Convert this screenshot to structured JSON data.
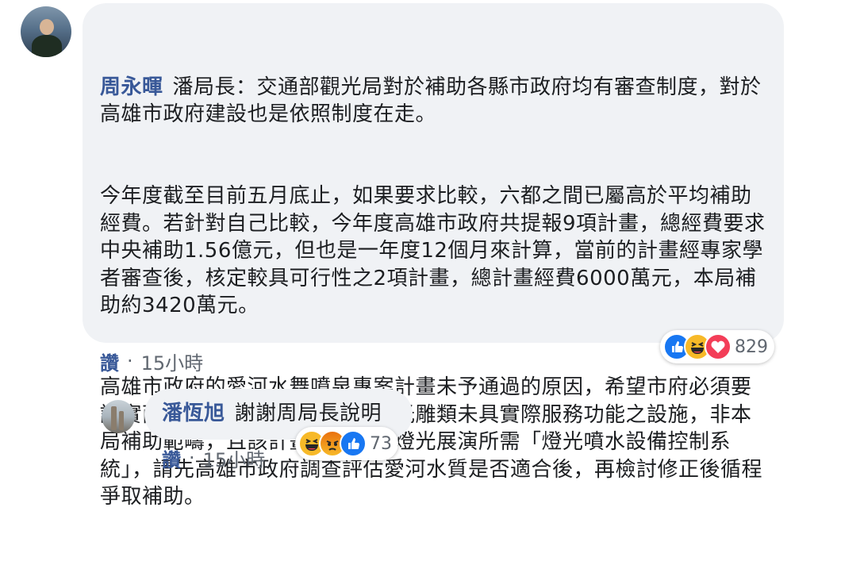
{
  "comments": [
    {
      "author": "周永暉",
      "paragraphs": [
        "潘局長：交通部觀光局對於補助各縣市政府均有審查制度，對於高雄市政府建設也是依照制度在走。",
        "今年度截至目前五月底止，如果要求比較，六都之間已屬高於平均補助經費。若針對自己比較，今年度高雄市政府共提報9項計畫，總經費要求中央補助1.56億元，但也是一年度12個月來計算，當前的計畫經專家學者審查後，核定較具可行性之2項計畫，總計畫經費6000萬元，本局補助約3420萬元。",
        "高雄市政府的愛河水舞噴泉專案計畫未予通過的原因，希望市府必須要誠實面對自己的問題，主要係因光雕類未具實際服務功能之設施，非本局補助範疇，且該計畫旨在建置燈光展演所需「燈光噴水設備控制系統」，請先高雄市政府調查評估愛河水質是否適合後，再檢討修正後循程爭取補助。"
      ],
      "like_label": "讚",
      "time": "15小時",
      "reactions": [
        "like-icon",
        "haha-icon",
        "love-icon"
      ],
      "reaction_count": "829"
    },
    {
      "author": "潘恆旭",
      "text": "謝謝周局長說明",
      "like_label": "讚",
      "time": "15小時",
      "reactions": [
        "haha-icon",
        "angry-icon",
        "like-icon"
      ],
      "reaction_count": "73"
    }
  ],
  "colors": {
    "link": "#385898",
    "bubble": "#f0f2f5",
    "meta": "#606770",
    "like_blue": "#1877f2",
    "haha_yellow": "#f7b928",
    "love_red": "#f33e58"
  }
}
